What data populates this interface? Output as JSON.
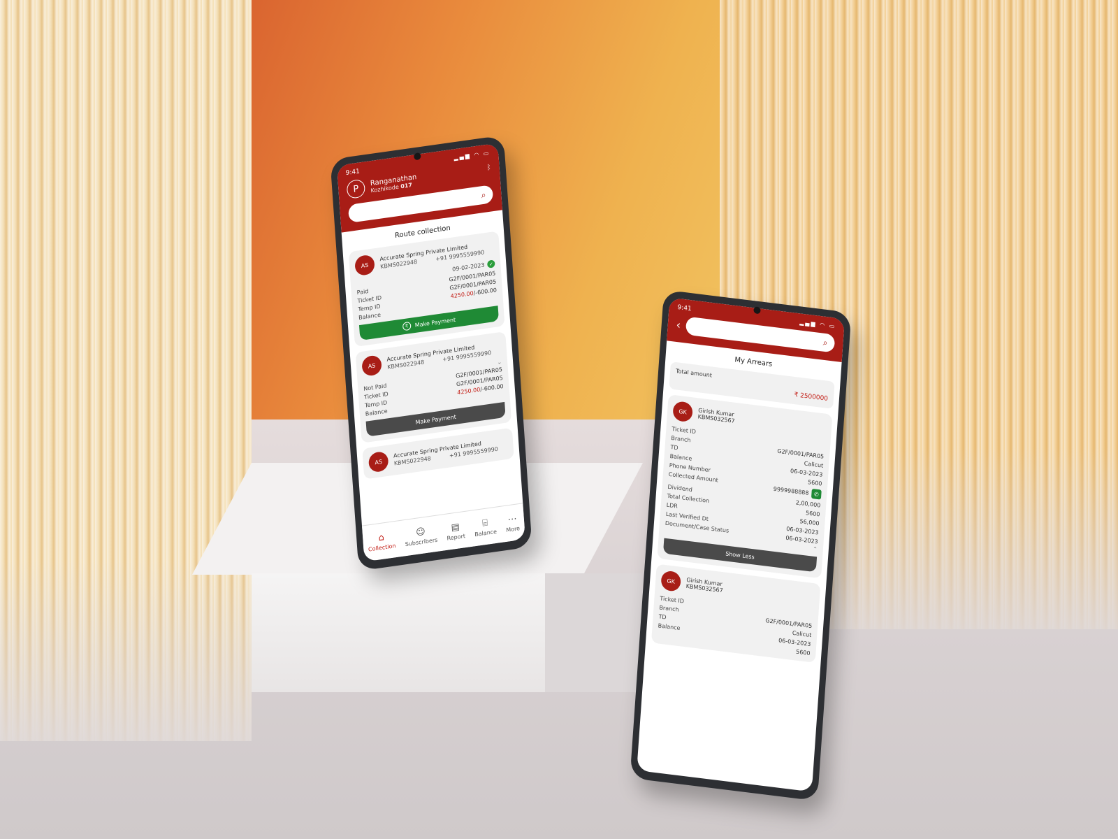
{
  "phone1": {
    "status_time": "9:41",
    "user": {
      "initial": "P",
      "name": "Ranganathan",
      "location": "Kozhikode",
      "location_code": "017"
    },
    "section_title": "Route collection",
    "cards": [
      {
        "initials": "AS",
        "company": "Accurate Spring Private Limited",
        "code": "KBMS022948",
        "phone": "+91 9995559990",
        "date": "09-02-2023",
        "status": "Paid",
        "ticket_id": "G2F/0001/PAR05",
        "temp_id": "G2F/0001/PAR05",
        "balance_red": "4250.00",
        "balance_rest": "/-600.00",
        "button": "Make Payment"
      },
      {
        "initials": "AS",
        "company": "Accurate Spring Private Limited",
        "code": "KBMS022948",
        "phone": "+91 9995559990",
        "status": "Not Paid",
        "ticket_id": "G2F/0001/PAR05",
        "temp_id": "G2F/0001/PAR05",
        "balance_red": "4250.00",
        "balance_rest": "/-600.00",
        "button": "Make Payment"
      },
      {
        "initials": "AS",
        "company": "Accurate Spring Private Limited",
        "code": "KBMS022948",
        "phone": "+91 9995559990"
      }
    ],
    "labels": {
      "ticket_id": "Ticket ID",
      "temp_id": "Temp ID",
      "balance": "Balance"
    },
    "nav": [
      "Collection",
      "Subscribers",
      "Report",
      "Balance",
      "More"
    ]
  },
  "phone2": {
    "status_time": "9:41",
    "section_title": "My Arrears",
    "total_label": "Total amount",
    "total_value": "₹ 2500000",
    "labels": {
      "ticket_id": "Ticket ID",
      "branch": "Branch",
      "td": "TD",
      "balance": "Balance",
      "phone_number": "Phone Number",
      "collected_amount": "Collected Amount",
      "dividend": "Dividend",
      "total_collection": "Total Collection",
      "ldr": "LDR",
      "last_verified": "Last Verified Dt",
      "document_status": "Document/Case Status"
    },
    "cards": [
      {
        "initials": "GK",
        "name": "Girish Kumar",
        "code": "KBMS032567",
        "values": [
          "G2F/0001/PAR05",
          "Calicut",
          "06-03-2023",
          "5600",
          "9999988888",
          "2,00,000",
          "5600",
          "56,000",
          "06-03-2023",
          "06-03-2023"
        ],
        "button": "Show Less"
      },
      {
        "initials": "GK",
        "name": "Girish Kumar",
        "code": "KBMS032567",
        "values": [
          "G2F/0001/PAR05",
          "Calicut",
          "06-03-2023",
          "5600"
        ]
      }
    ]
  }
}
